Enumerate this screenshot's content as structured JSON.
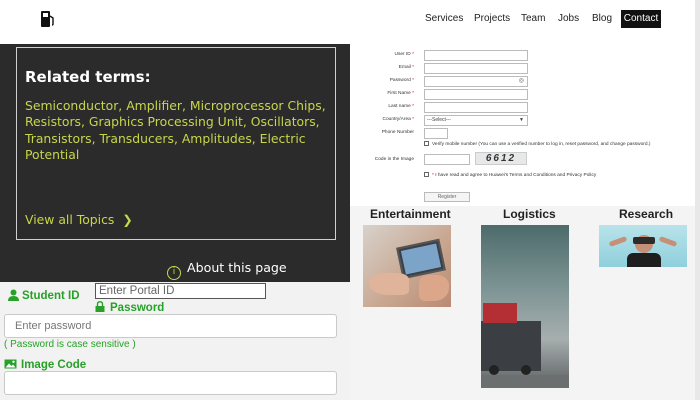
{
  "nav": {
    "items": [
      "Services",
      "Projects",
      "Team",
      "Jobs",
      "Blog"
    ],
    "contact": "Contact"
  },
  "related": {
    "title": "Related terms:",
    "terms": "Semiconductor, Amplifier, Microprocessor Chips, Resistors, Graphics Processing Unit, Oscillators, Transistors, Transducers, Amplitudes, Electric Potential",
    "view_all": "View all Topics",
    "about": "About this page"
  },
  "login": {
    "student_id_label": "Student ID",
    "portal_placeholder": "Enter Portal ID",
    "password_label": "Password",
    "password_placeholder": "Enter password",
    "password_hint": "( Password is case sensitive )",
    "image_code_label": "Image Code"
  },
  "register": {
    "fields": {
      "user_id": "User ID",
      "email": "Email",
      "password": "Password",
      "first_name": "First Name",
      "last_name": "Last name",
      "country": "Country/Area",
      "phone": "Phone Number",
      "code": "Code in the Image"
    },
    "country_value": "---Select---",
    "verify_text": "Verify mobile number (You can use a verified number to log in, reset password, and change password.)",
    "captcha": "6612",
    "agree_text": "I have read and agree to Huawei's Terms and Conditions and Privacy Policy",
    "register_button": "Register"
  },
  "categories": [
    "Entertainment",
    "Logistics",
    "Research"
  ],
  "colors": {
    "accent_green": "#28a128",
    "terms_yellow": "#c8d64a",
    "dark_panel": "#2b2b2b"
  }
}
